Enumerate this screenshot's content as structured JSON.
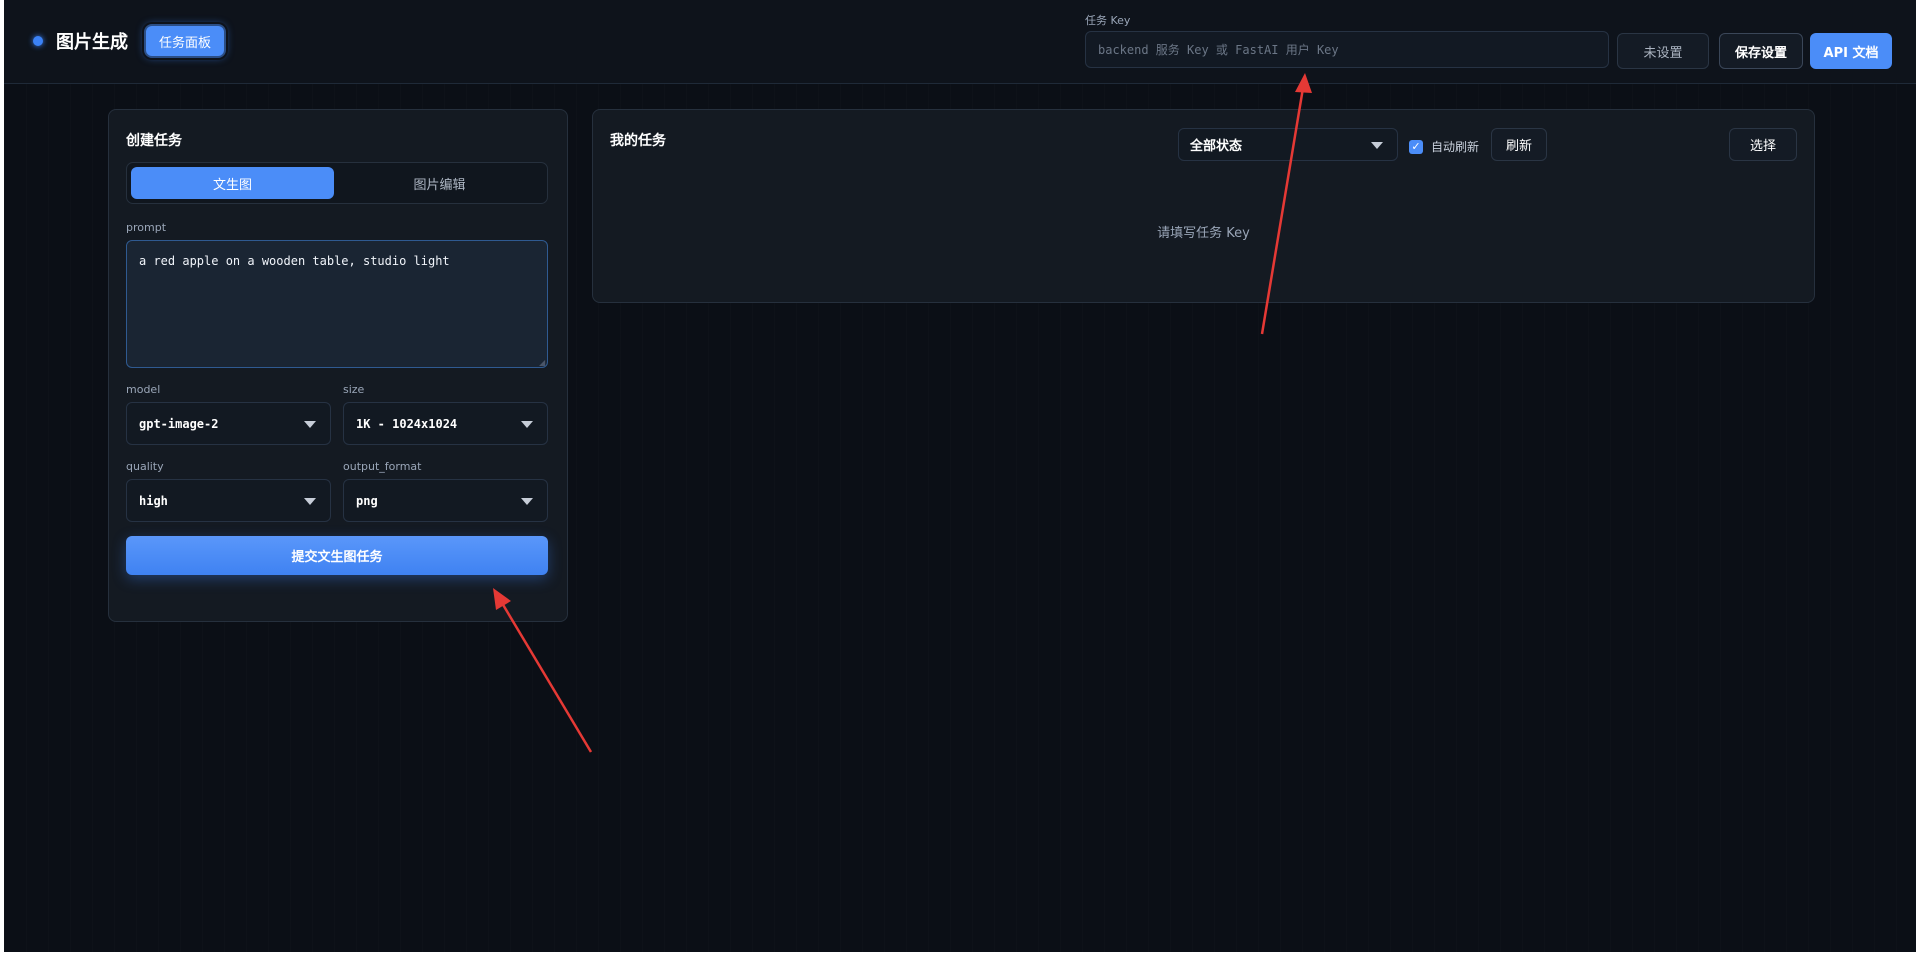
{
  "header": {
    "brand_title": "图片生成",
    "task_panel_button": "任务面板",
    "key_label": "任务 Key",
    "key_placeholder": "backend 服务 Key 或 FastAI 用户 Key",
    "key_value": "",
    "unset_button": "未设置",
    "save_button": "保存设置",
    "api_docs_button": "API 文档"
  },
  "create_task": {
    "title": "创建任务",
    "tabs": [
      {
        "label": "文生图",
        "active": true
      },
      {
        "label": "图片编辑",
        "active": false
      }
    ],
    "prompt_label": "prompt",
    "prompt_value": "a red apple on a wooden table, studio light",
    "model_label": "model",
    "model_value": "gpt-image-2",
    "size_label": "size",
    "size_value": "1K - 1024x1024",
    "quality_label": "quality",
    "quality_value": "high",
    "output_format_label": "output_format",
    "output_format_value": "png",
    "submit_button": "提交文生图任务"
  },
  "my_tasks": {
    "title": "我的任务",
    "status_filter": "全部状态",
    "auto_refresh_label": "自动刷新",
    "auto_refresh_checked": true,
    "refresh_button": "刷新",
    "select_button": "选择",
    "empty_message": "请填写任务 Key"
  },
  "colors": {
    "accent": "#4b8df8",
    "background": "#0b0f16",
    "panel": "#141a22",
    "annotation_arrow": "#e53935"
  }
}
